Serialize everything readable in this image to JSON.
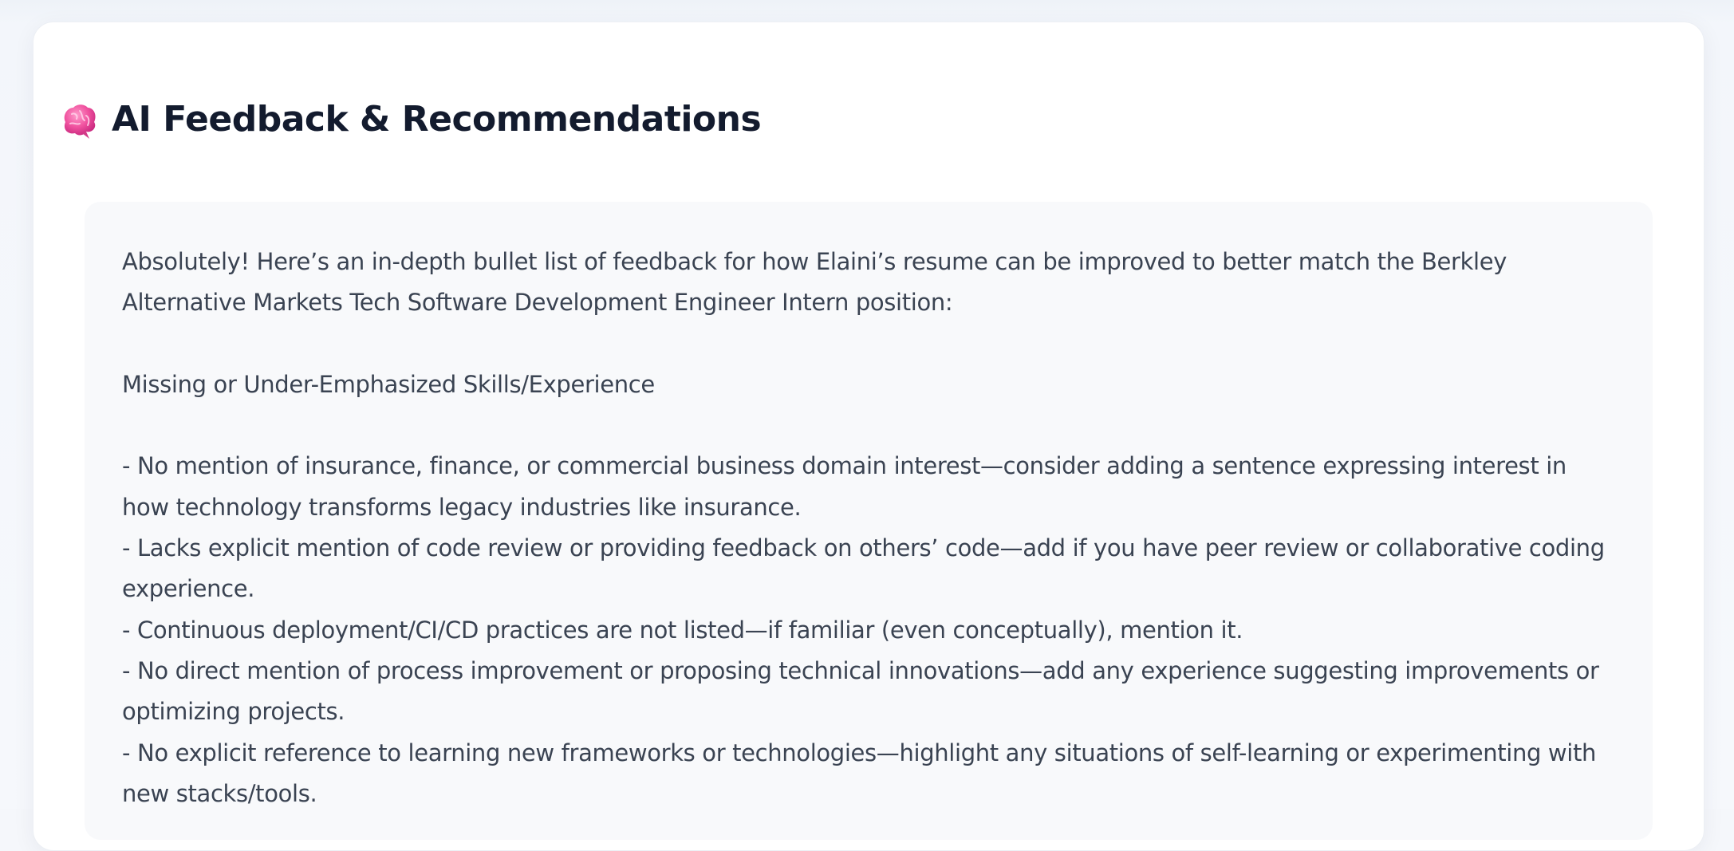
{
  "section": {
    "icon": "brain-icon",
    "title": "AI Feedback & Recommendations"
  },
  "feedback": {
    "intro": "Absolutely! Here’s an in-depth bullet list of feedback for how Elaini’s resume can be improved to better match the Berkley Alternative Markets Tech Software Development Engineer Intern position:",
    "subheading": "Missing or Under-Emphasized Skills/Experience",
    "bullets": [
      "- No mention of insurance, finance, or commercial business domain interest—consider adding a sentence expressing interest in how technology transforms legacy industries like insurance.",
      "- Lacks explicit mention of code review or providing feedback on others’ code—add if you have peer review or collaborative coding experience.",
      "- Continuous deployment/CI/CD practices are not listed—if familiar (even conceptually), mention it.",
      "- No direct mention of process improvement or proposing technical innovations—add any experience suggesting improvements or optimizing projects.",
      "- No explicit reference to learning new frameworks or technologies—highlight any situations of self-learning or experimenting with new stacks/tools."
    ]
  },
  "colors": {
    "accent_brain": "#ec4fa0",
    "title_text": "#131b2e",
    "body_text": "#3a4352",
    "panel_bg": "#f8f9fb"
  }
}
